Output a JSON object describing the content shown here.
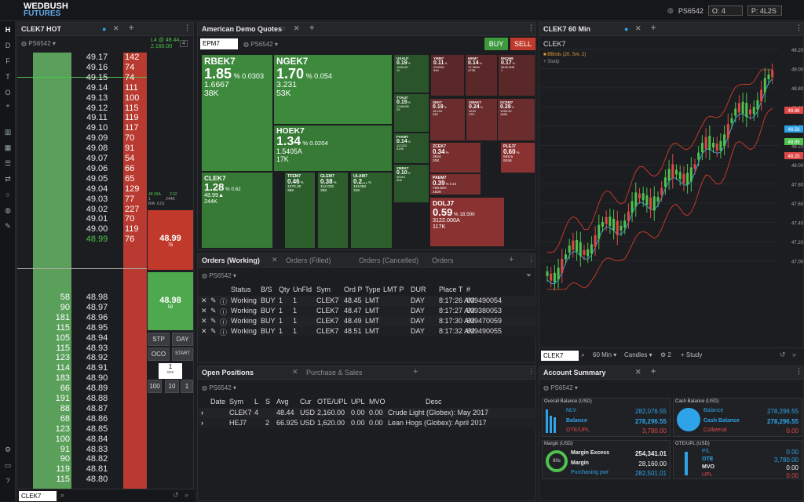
{
  "topbar": {
    "brand_line1": "WEDBUSH",
    "brand_line2": "FUTURES",
    "account": "PS6542",
    "o_label": "O: 4",
    "p_label": "P: 4L2S"
  },
  "nav": [
    "H",
    "D",
    "F",
    "T",
    "O",
    "+"
  ],
  "ladder": {
    "title": "CLEK7 HOT",
    "account": "PS6542",
    "info1": "L4 @ 48.44",
    "info2": "2,160.00",
    "qty_badge": "4",
    "ask_rows": [
      [
        "49.17",
        "142"
      ],
      [
        "49.16",
        "74"
      ],
      [
        "49.15",
        "74"
      ],
      [
        "49.14",
        "111"
      ],
      [
        "49.13",
        "100"
      ],
      [
        "49.12",
        "115"
      ],
      [
        "49.11",
        "119"
      ],
      [
        "49.10",
        "117"
      ],
      [
        "49.09",
        "70"
      ],
      [
        "49.08",
        "91"
      ],
      [
        "49.07",
        "54"
      ],
      [
        "49.06",
        "66"
      ],
      [
        "49.05",
        "65"
      ],
      [
        "49.04",
        "129"
      ],
      [
        "49.03",
        "77"
      ],
      [
        "49.02",
        "227"
      ],
      [
        "49.01",
        "70"
      ],
      [
        "49.00",
        "119"
      ],
      [
        "48.99",
        "76"
      ]
    ],
    "bid_rows": [
      [
        "58",
        "48.98"
      ],
      [
        "90",
        "48.97"
      ],
      [
        "181",
        "48.96"
      ],
      [
        "115",
        "48.95"
      ],
      [
        "105",
        "48.94"
      ],
      [
        "115",
        "48.93"
      ],
      [
        "123",
        "48.92"
      ],
      [
        "114",
        "48.91"
      ],
      [
        "183",
        "48.90"
      ],
      [
        "66",
        "48.89"
      ],
      [
        "191",
        "48.88"
      ],
      [
        "88",
        "48.87"
      ],
      [
        "68",
        "48.86"
      ],
      [
        "123",
        "48.85"
      ],
      [
        "100",
        "48.84"
      ],
      [
        "91",
        "48.83"
      ],
      [
        "90",
        "48.82"
      ],
      [
        "119",
        "48.81"
      ],
      [
        "115",
        "48.80"
      ]
    ],
    "mini1": "48.99A",
    "mini2": "2.62",
    "mini3": "1",
    "mini4": "244K",
    "mini5": "B/A: 0.01",
    "sell_price": "48.99",
    "sell_sub": "76",
    "buy_price": "48.98",
    "buy_sub": "58",
    "stp": "STP",
    "day": "DAY",
    "oco": "OCO",
    "start": "START",
    "qty": "1",
    "qty_label": "size",
    "q10": "10",
    "q100": "100",
    "q1": "1",
    "symbol_input": "CLEK7"
  },
  "quotes": {
    "title": "American Demo Quotes",
    "symbol": "EPM7",
    "account": "PS6542",
    "buy": "BUY",
    "sell": "SELL",
    "tiles": [
      {
        "sym": "RBEK7",
        "pct": "1.85",
        "chg": "0.0303",
        "l1": "1.6667",
        "l2": "38K",
        "color": "#3d8a3d"
      },
      {
        "sym": "NGEK7",
        "pct": "1.70",
        "chg": "0.054",
        "l1": "3.231",
        "l2": "53K",
        "color": "#3d8a3d"
      },
      {
        "sym": "HOEK7",
        "pct": "1.34",
        "chg": "0.0204",
        "l1": "1.5405A",
        "l2": "17K",
        "color": "#367a36"
      },
      {
        "sym": "CLEK7",
        "pct": "1.28",
        "chg": "0.62",
        "l1": "48.99▲",
        "l2": "244K",
        "color": "#367a36"
      },
      {
        "sym": "TFEM7",
        "pct": "0.46",
        "chg": "",
        "l1": "1370.30",
        "l2": "38K",
        "color": "#2c5f2c"
      },
      {
        "sym": "GLEM7",
        "pct": "0.38",
        "chg": "",
        "l1": "112.025",
        "l2": "35K",
        "color": "#2c5f2c"
      },
      {
        "sym": "ULAM7",
        "pct": "0.2...",
        "chg": "",
        "l1": "161058",
        "l2": "34K",
        "color": "#2c5f2c"
      },
      {
        "sym": "USAU7",
        "pct": "0.19",
        "chg": "",
        "l1": "1526.00",
        "l2": "11",
        "color": "#2a552a"
      },
      {
        "sym": "TYAU7",
        "pct": "0.15",
        "chg": "",
        "l1": "1246108",
        "l2": "29",
        "color": "#2a552a"
      },
      {
        "sym": "FVAM7",
        "pct": "0.14",
        "chg": "",
        "l1": "117222",
        "l2": "319K",
        "color": "#2a552a"
      },
      {
        "sym": "ZMEK7",
        "pct": "0.10",
        "chg": "",
        "l1": "30010",
        "l2": "30K",
        "color": "#2a552a"
      },
      {
        "sym": "YMM7",
        "pct": "0.11",
        "chg": "",
        "l1": "20903A",
        "l2": "54K",
        "color": "#5a2828"
      },
      {
        "sym": "HEM7",
        "pct": "0.14",
        "chg": "",
        "l1": "72.350A",
        "l2": "472B",
        "color": "#5a2828"
      },
      {
        "sym": "ENQH8",
        "pct": "0.17",
        "chg": "",
        "l1": "5406.50B",
        "l2": "1",
        "color": "#5a2828"
      },
      {
        "sym": "SEK7",
        "pct": "0.19",
        "chg": "",
        "l1": "18.215",
        "l2": "33K",
        "color": "#6a2c2c"
      },
      {
        "sym": "ZWAK7",
        "pct": "0.24",
        "chg": "",
        "l1": "4234",
        "l2": "27K",
        "color": "#6a2c2c"
      },
      {
        "sym": "GCEM7",
        "pct": "0.28",
        "chg": "",
        "l1": "1255.30",
        "l2": "166K",
        "color": "#6a2c2c"
      },
      {
        "sym": "ZCEK7",
        "pct": "0.34",
        "chg": "",
        "l1": "3624",
        "l2": "20K",
        "color": "#7a2f2f"
      },
      {
        "sym": "PLEJ7",
        "pct": "0.60",
        "chg": "",
        "l1": "949.5",
        "l2": "9346",
        "color": "#8a3232"
      },
      {
        "sym": "PAEM7",
        "pct": "0.39",
        "chg": "3.10",
        "l1": "789.50A",
        "l2": "1829",
        "color": "#7a2f2f"
      },
      {
        "sym": "DOLJ7",
        "pct": "0.59",
        "chg": "18.500",
        "l1": "3122.000A",
        "l2": "117K",
        "color": "#8a3232"
      }
    ]
  },
  "orders": {
    "tabs": [
      "Orders (Working)",
      "Orders (Filled)",
      "Orders (Cancelled)",
      "Orders"
    ],
    "account": "PS6542",
    "headers": [
      "Status",
      "B/S",
      "Qty",
      "UnFld",
      "Sym",
      "Ord P",
      "Type",
      "LMT P",
      "DUR",
      "Place T",
      "#"
    ],
    "rows": [
      [
        "Working",
        "BUY",
        "1",
        "1",
        "CLEK7",
        "48.45",
        "LMT",
        "",
        "DAY",
        "8:17:26 AM",
        "609490054"
      ],
      [
        "Working",
        "BUY",
        "1",
        "1",
        "CLEK7",
        "48.47",
        "LMT",
        "",
        "DAY",
        "8:17:27 AM",
        "609380053"
      ],
      [
        "Working",
        "BUY",
        "1",
        "1",
        "CLEK7",
        "48.49",
        "LMT",
        "",
        "DAY",
        "8:17:30 AM",
        "609470059"
      ],
      [
        "Working",
        "BUY",
        "1",
        "1",
        "CLEK7",
        "48.51",
        "LMT",
        "",
        "DAY",
        "8:17:32 AM",
        "609490055"
      ]
    ]
  },
  "positions": {
    "tabs": [
      "Open Positions",
      "Purchase & Sales"
    ],
    "account": "PS6542",
    "headers": [
      "Date",
      "Sym",
      "L",
      "S",
      "Avg",
      "Cur",
      "OTE/UPL",
      "UPL",
      "MVO",
      "Desc"
    ],
    "rows": [
      [
        "",
        "CLEK7",
        "4",
        "",
        "48.44",
        "USD",
        "2,160.00",
        "0.00",
        "0.00",
        "Crude Light (Globex): May 2017"
      ],
      [
        "",
        "HEJ7",
        "",
        "2",
        "66.925",
        "USD",
        "1,620.00",
        "0.00",
        "0.00",
        "Lean Hogs (Globex): April 2017"
      ]
    ]
  },
  "chart": {
    "title": "CLEK7 60 Min",
    "symbol_label": "CLEK7",
    "indicator": "BBnds (20, Sm, 2)",
    "study": "+ Study",
    "price_ticks": [
      "49.20",
      "49.00",
      "48.80",
      "48.60",
      "48.40",
      "48.20",
      "48.00",
      "47.80",
      "47.60",
      "47.40",
      "47.20",
      "47.00"
    ],
    "markers": [
      {
        "v": "48.86",
        "c": "#e04848"
      },
      {
        "v": "48.58",
        "c": "#2ea3e8"
      },
      {
        "v": "48.20",
        "c": "#e04848"
      },
      {
        "v": "48.99",
        "c": "#4fc24f"
      }
    ],
    "volume_label": "Volume (Con)",
    "vol_ticks": [
      "75000",
      "50000",
      "25000"
    ],
    "vol_marker": "67943",
    "time_ticks": [
      "6:00",
      "12:00",
      "18:00",
      "28-00:00",
      "6:00",
      "12:00",
      "18:00",
      "29-00:00",
      "6:00"
    ],
    "symbol_input": "CLEK7",
    "interval": "60 Min",
    "style": "Candles",
    "count": "2",
    "study_btn": "+ Study"
  },
  "account": {
    "title": "Account Summary",
    "account": "PS6542",
    "overall_title": "Overall Balance (USD)",
    "nlv_label": "NLV",
    "nlv": "282,076.55",
    "bal_label": "Balance",
    "bal": "278,296.55",
    "ote_label": "OTE/UPL",
    "ote": "3,780.00",
    "cash_title": "Cash Balance (USD)",
    "cb_label": "Balance",
    "cb": "278,296.55",
    "cash_label": "Cash Balance",
    "cash": "278,296.55",
    "coll_label": "Collateral",
    "coll": "0.00",
    "margin_title": "Margin (USD)",
    "pct": "90s",
    "mx_label": "Margin Excess",
    "mx": "254,341.01",
    "m_label": "Margin",
    "m": "28,160.00",
    "pp_label": "Purchasing pwr",
    "pp": "282,501.01",
    "oteupl_title": "OTE/UPL (USD)",
    "pl_label": "P/L",
    "pl": "0.00",
    "o_label": "OTE",
    "o": "3,780.00",
    "mvo_label": "MVO",
    "mvo": "0.00",
    "upl_label": "UPL",
    "upl": "0.00"
  },
  "colors": {
    "green": "#4fc24f",
    "red": "#e04848",
    "blue": "#2ea3e8",
    "bid_bg": "#5aa05a",
    "ask_bg": "#b83a30"
  }
}
